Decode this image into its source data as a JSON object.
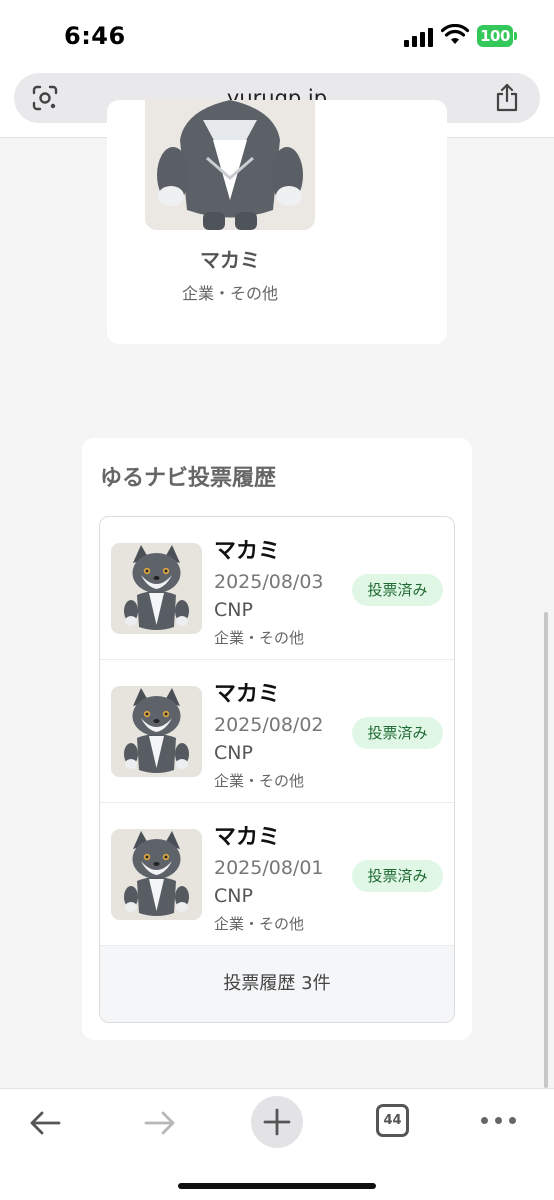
{
  "status_bar": {
    "time": "6:46",
    "battery": "100"
  },
  "browser": {
    "url": "yurugp.jp",
    "tab_count": "44"
  },
  "top_card": {
    "name": "マカミ",
    "category": "企業・その他"
  },
  "history": {
    "title": "ゆるナビ投票履歴",
    "items": [
      {
        "name": "マカミ",
        "date": "2025/08/03",
        "org": "CNP",
        "category": "企業・その他",
        "status": "投票済み"
      },
      {
        "name": "マカミ",
        "date": "2025/08/02",
        "org": "CNP",
        "category": "企業・その他",
        "status": "投票済み"
      },
      {
        "name": "マカミ",
        "date": "2025/08/01",
        "org": "CNP",
        "category": "企業・その他",
        "status": "投票済み"
      }
    ],
    "footer": "投票履歴 3件"
  },
  "colors": {
    "accent_green": "#34c759",
    "badge_bg": "#e0f7e6",
    "badge_text": "#1f6b33"
  }
}
